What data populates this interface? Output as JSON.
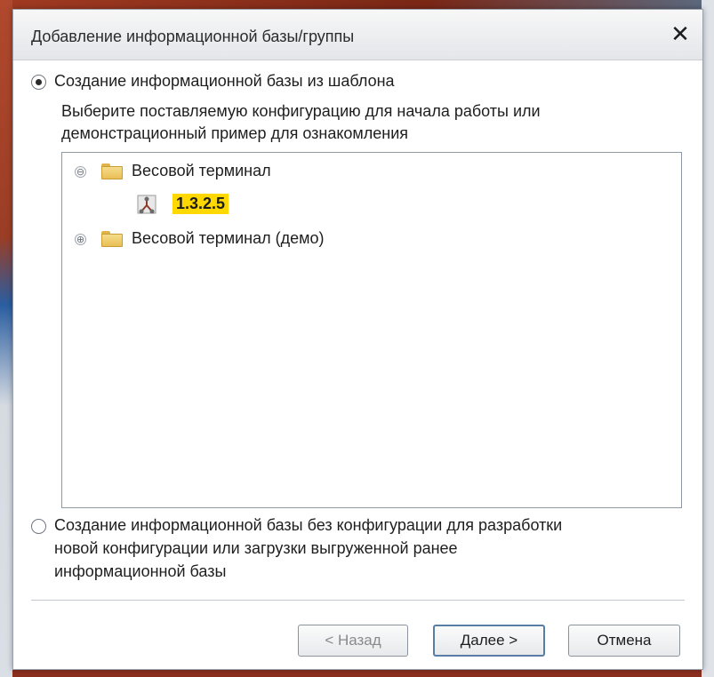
{
  "window": {
    "title": "Добавление информационной базы/группы",
    "close_glyph": "✕"
  },
  "options": {
    "from_template": {
      "label": "Создание информационной базы из шаблона",
      "selected": true,
      "description_line1": "Выберите поставляемую конфигурацию для начала работы или",
      "description_line2": "демонстрационный пример для ознакомления"
    },
    "without_config": {
      "selected": false,
      "label_line1": "Создание информационной базы без конфигурации для разработки",
      "label_line2": "новой конфигурации или загрузки выгруженной ранее",
      "label_line3": "информационной базы"
    }
  },
  "tree": {
    "items": [
      {
        "label": "Весовой терминал",
        "expander": "⊖",
        "icon": "folder-icon",
        "expanded": true
      },
      {
        "label": "1.3.2.5",
        "icon": "configuration-icon",
        "selected": true,
        "highlight_color": "#ffd800"
      },
      {
        "label": "Весовой терминал (демо)",
        "expander": "⊕",
        "icon": "folder-icon",
        "expanded": false
      }
    ]
  },
  "buttons": {
    "back": "< Назад",
    "next": "Далее >",
    "cancel": "Отмена"
  }
}
